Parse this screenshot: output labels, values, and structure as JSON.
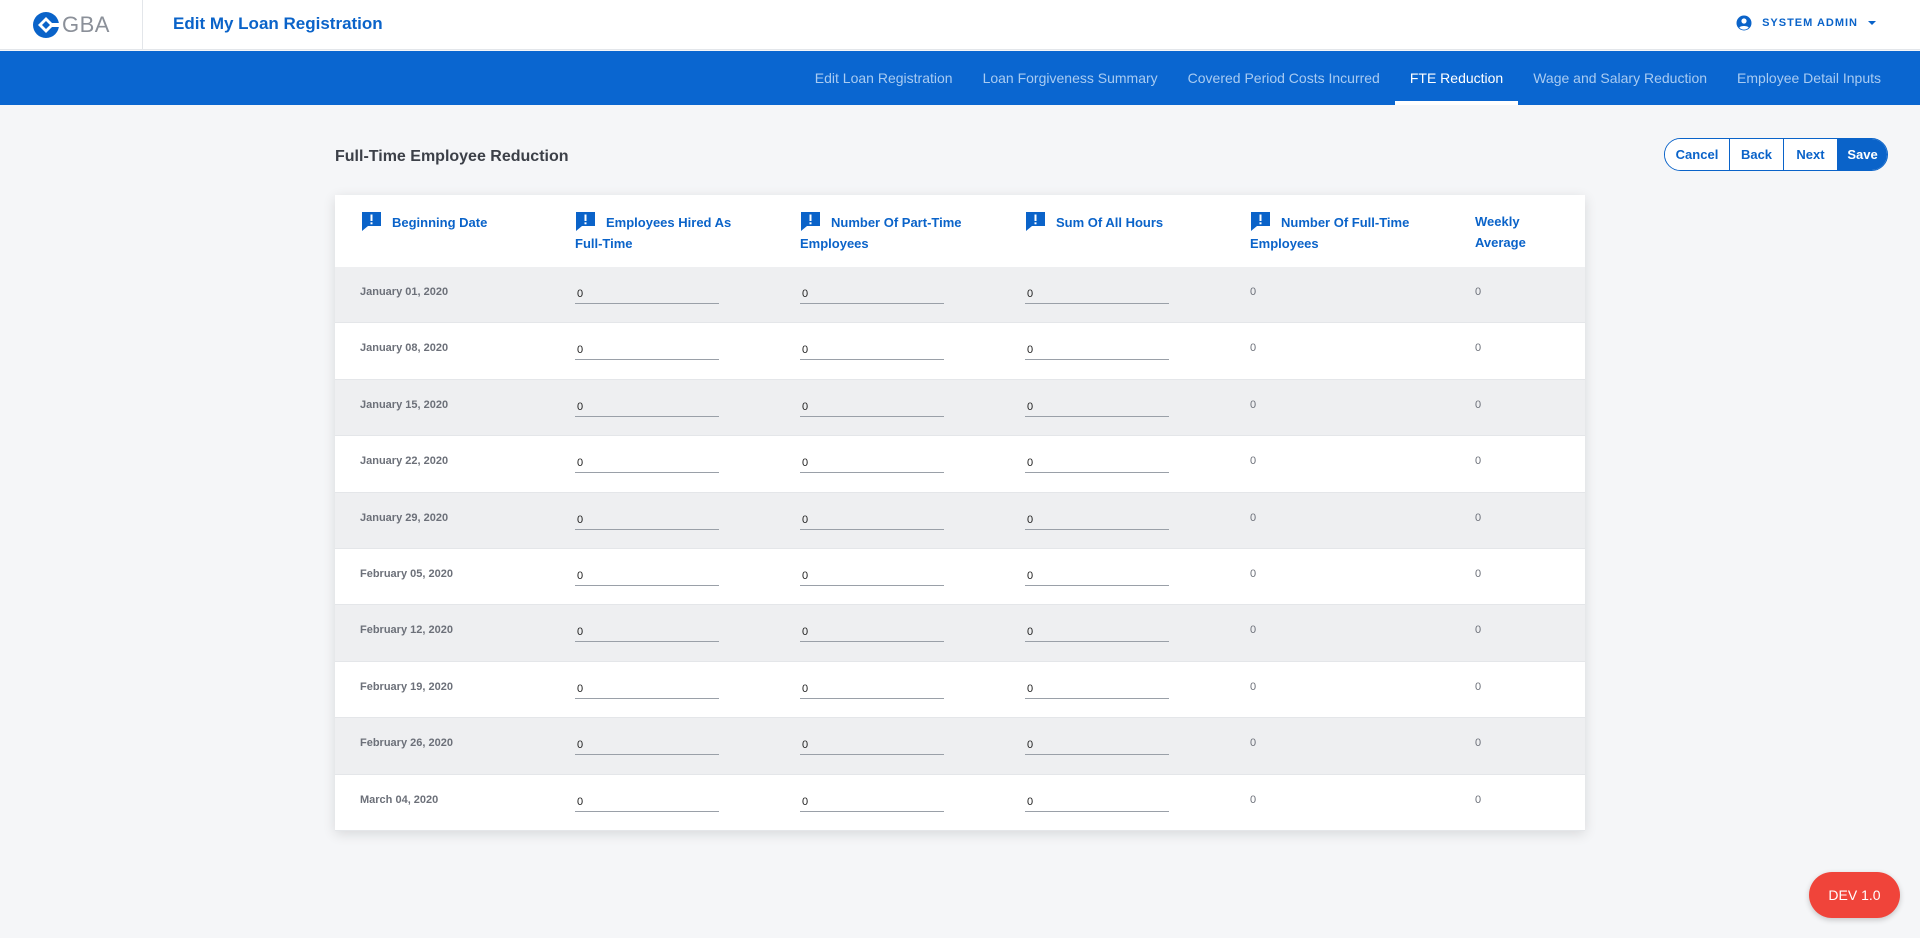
{
  "header": {
    "brand_text": "GBA",
    "page_title": "Edit My Loan Registration",
    "user_name": "SYSTEM ADMIN"
  },
  "nav": {
    "tabs": [
      {
        "label": "Edit Loan Registration",
        "active": false
      },
      {
        "label": "Loan Forgiveness Summary",
        "active": false
      },
      {
        "label": "Covered Period Costs Incurred",
        "active": false
      },
      {
        "label": "FTE Reduction",
        "active": true
      },
      {
        "label": "Wage and Salary Reduction",
        "active": false
      },
      {
        "label": "Employee Detail Inputs",
        "active": false
      }
    ]
  },
  "section": {
    "title": "Full-Time Employee Reduction"
  },
  "actions": {
    "cancel": "Cancel",
    "back": "Back",
    "next": "Next",
    "save": "Save"
  },
  "table": {
    "columns": [
      {
        "label": "Beginning Date",
        "icon": "alert-comment-icon"
      },
      {
        "label": "Employees Hired As Full-Time",
        "icon": "alert-comment-icon"
      },
      {
        "label": "Number Of Part-Time Employees",
        "icon": "alert-comment-icon"
      },
      {
        "label": "Sum Of All Hours",
        "icon": "alert-comment-icon"
      },
      {
        "label": "Number Of Full-Time Employees",
        "icon": "alert-comment-icon"
      },
      {
        "label": "Weekly Average",
        "icon": ""
      }
    ],
    "rows": [
      {
        "date": "January 01, 2020",
        "hired_full_time": "0",
        "part_time": "0",
        "sum_hours": "0",
        "full_time": "0",
        "weekly_average": "0"
      },
      {
        "date": "January 08, 2020",
        "hired_full_time": "0",
        "part_time": "0",
        "sum_hours": "0",
        "full_time": "0",
        "weekly_average": "0"
      },
      {
        "date": "January 15, 2020",
        "hired_full_time": "0",
        "part_time": "0",
        "sum_hours": "0",
        "full_time": "0",
        "weekly_average": "0"
      },
      {
        "date": "January 22, 2020",
        "hired_full_time": "0",
        "part_time": "0",
        "sum_hours": "0",
        "full_time": "0",
        "weekly_average": "0"
      },
      {
        "date": "January 29, 2020",
        "hired_full_time": "0",
        "part_time": "0",
        "sum_hours": "0",
        "full_time": "0",
        "weekly_average": "0"
      },
      {
        "date": "February 05, 2020",
        "hired_full_time": "0",
        "part_time": "0",
        "sum_hours": "0",
        "full_time": "0",
        "weekly_average": "0"
      },
      {
        "date": "February 12, 2020",
        "hired_full_time": "0",
        "part_time": "0",
        "sum_hours": "0",
        "full_time": "0",
        "weekly_average": "0"
      },
      {
        "date": "February 19, 2020",
        "hired_full_time": "0",
        "part_time": "0",
        "sum_hours": "0",
        "full_time": "0",
        "weekly_average": "0"
      },
      {
        "date": "February 26, 2020",
        "hired_full_time": "0",
        "part_time": "0",
        "sum_hours": "0",
        "full_time": "0",
        "weekly_average": "0"
      },
      {
        "date": "March 04, 2020",
        "hired_full_time": "0",
        "part_time": "0",
        "sum_hours": "0",
        "full_time": "0",
        "weekly_average": "0"
      }
    ]
  },
  "badge": {
    "label": "DEV 1.0"
  },
  "colors": {
    "brand_blue": "#0a63c9",
    "nav_blue": "#0a66d0",
    "badge_red": "#f0443a"
  }
}
